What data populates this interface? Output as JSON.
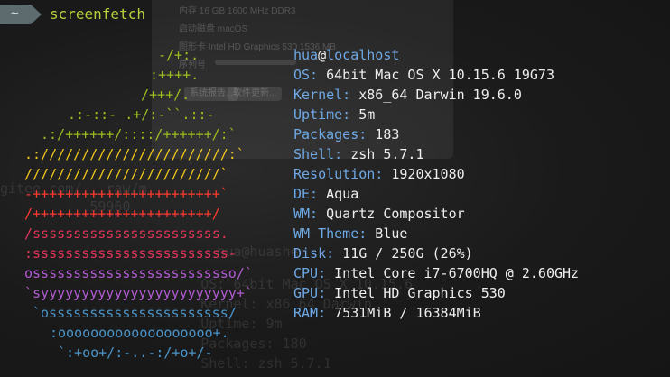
{
  "prompt": {
    "tilde": "~",
    "command": "screenfetch"
  },
  "background_window": {
    "rows": [
      "内存     16 GB 1600 MHz DDR3",
      "启动磁盘    macOS",
      "图形卡     Intel HD Graphics 530 1536 MB",
      "序列号"
    ],
    "buttons": [
      "系统报告...",
      "软件更新..."
    ]
  },
  "ghost_terminal": {
    "lines": [
      "gitee.com/...raw/m",
      "        ...59960",
      "          hua@huashe",
      "        OS: 64bit Mac OS X 10.15.6",
      "        Kernel: x86_64 Darwin",
      "        Uptime: 9m",
      "        Packages: 180",
      "        Shell: zsh 5.7.1"
    ]
  },
  "logo": {
    "lines": [
      {
        "text": "-/+:.",
        "color": "#9bbf1e"
      },
      {
        "text": ":++++.",
        "color": "#9bbf1e"
      },
      {
        "text": "/+++/.",
        "color": "#9bbf1e"
      },
      {
        "text": ".:-::- .+/:-``.::-",
        "color": "#9bbf1e"
      },
      {
        "text": ".:/++++++/::::/++++++/:`",
        "color": "#9bbf1e"
      },
      {
        "text": ".:///////////////////////:`",
        "color": "#f2c81b"
      },
      {
        "text": "////////////////////////`",
        "color": "#f2c81b"
      },
      {
        "text": "-+++++++++++++++++++++++`",
        "color": "#ff3b2f"
      },
      {
        "text": "/++++++++++++++++++++++/",
        "color": "#ff3b2f"
      },
      {
        "text": "/sssssssssssssssssssssss.",
        "color": "#e3345a"
      },
      {
        "text": ":ssssssssssssssssssssssss-",
        "color": "#e3345a"
      },
      {
        "text": "osssssssssssssssssssssssso/`",
        "color": "#b05bd1"
      },
      {
        "text": "`syyyyyyyyyyyyyyyyyyyyyyyy+`",
        "color": "#b05bd1"
      },
      {
        "text": "`ossssssssssssssssssssss/",
        "color": "#4a94c8"
      },
      {
        "text": ":ooooooooooooooooooo+.",
        "color": "#4a94c8"
      },
      {
        "text": "`:+oo+/:-..-:/+o+/-",
        "color": "#4a94c8"
      }
    ]
  },
  "info": {
    "user": "hua",
    "at": "@",
    "host": "localhost",
    "items": [
      {
        "key": "OS:",
        "value": " 64bit Mac OS X 10.15.6 19G73"
      },
      {
        "key": "Kernel:",
        "value": " x86_64 Darwin 19.6.0"
      },
      {
        "key": "Uptime:",
        "value": " 5m"
      },
      {
        "key": "Packages:",
        "value": " 183"
      },
      {
        "key": "Shell:",
        "value": " zsh 5.7.1"
      },
      {
        "key": "Resolution:",
        "value": " 1920x1080"
      },
      {
        "key": "DE:",
        "value": " Aqua"
      },
      {
        "key": "WM:",
        "value": " Quartz Compositor"
      },
      {
        "key": "WM Theme:",
        "value": " Blue"
      },
      {
        "key": "Disk:",
        "value": " 11G / 250G (26%)"
      },
      {
        "key": "CPU:",
        "value": " Intel Core i7-6700HQ @ 2.60GHz"
      },
      {
        "key": "GPU:",
        "value": " Intel HD Graphics 530"
      },
      {
        "key": "RAM:",
        "value": " 7531MiB / 16384MiB"
      }
    ]
  }
}
